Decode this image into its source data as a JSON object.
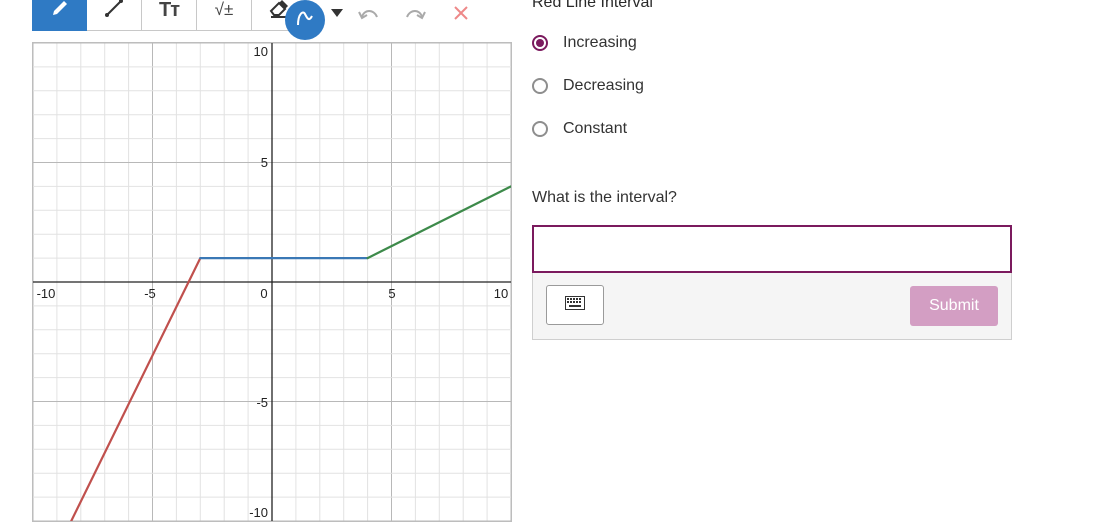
{
  "toolbar": {
    "tools": [
      {
        "name": "pencil-icon",
        "active": true
      },
      {
        "name": "line-icon",
        "active": false
      },
      {
        "name": "text-size-icon",
        "label": "Tт",
        "active": false
      },
      {
        "name": "math-symbols-icon",
        "label": "√±",
        "active": false
      },
      {
        "name": "eraser-icon",
        "active": false
      }
    ],
    "curve_tool": "curve-icon",
    "undo": "undo-icon",
    "redo": "redo-icon",
    "clear": "close-icon"
  },
  "graph": {
    "x_range": [
      -10,
      10
    ],
    "y_range": [
      -10,
      10
    ],
    "tick_labels": {
      "x_neg10": "-10",
      "x_neg5": "-5",
      "x_0": "0",
      "x_5": "5",
      "x_10": "10",
      "y_10": "10",
      "y_5": "5",
      "y_neg5": "-5",
      "y_neg10": "-10"
    },
    "segments": [
      {
        "color": "#c0504d",
        "from": [
          -8.4,
          -10
        ],
        "to": [
          -3,
          1
        ]
      },
      {
        "color": "#3a78b5",
        "from": [
          -3,
          1
        ],
        "to": [
          4,
          1
        ]
      },
      {
        "color": "#3d8a4a",
        "from": [
          4,
          1
        ],
        "to": [
          10,
          4
        ]
      }
    ]
  },
  "panel": {
    "title": "Red Line Interval",
    "options": [
      {
        "label": "Increasing",
        "checked": true
      },
      {
        "label": "Decreasing",
        "checked": false
      },
      {
        "label": "Constant",
        "checked": false
      }
    ],
    "question": "What is the interval?",
    "answer_value": "",
    "keyboard_icon": "keyboard-icon",
    "submit_label": "Submit"
  },
  "colors": {
    "accent": "#2f7ac4",
    "selection": "#7b1a5e",
    "submit_disabled": "#d39ec3"
  }
}
